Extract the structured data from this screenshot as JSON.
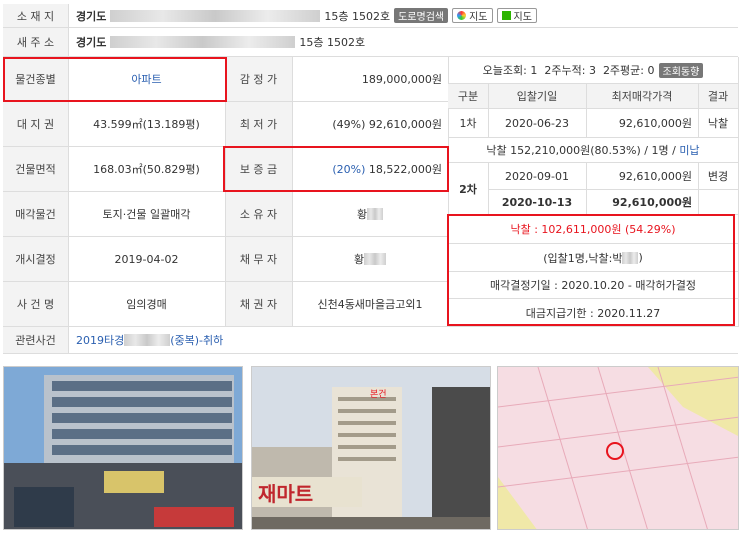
{
  "address": {
    "location_label": "소 재 지",
    "location_prefix": "경기도",
    "location_suffix": "15층 1502호",
    "road_btn": "도로명검색",
    "map_btn_1": "지도",
    "map_btn_2": "지도",
    "new_label": "새 주 소",
    "new_prefix": "경기도",
    "new_suffix": "15층 1502호"
  },
  "rows": {
    "kind_label": "물건종별",
    "kind_value": "아파트",
    "appraisal_label": "감 정 가",
    "appraisal_value": "189,000,000원",
    "land_label": "대 지 권",
    "land_value": "43.599㎡(13.189평)",
    "min_label": "최 저 가",
    "min_value": "(49%) 92,610,000원",
    "building_label": "건물면적",
    "building_value": "168.03㎡(50.829평)",
    "deposit_label": "보 증 금",
    "deposit_pct": "(20%)",
    "deposit_value": "18,522,000원",
    "sale_label": "매각물건",
    "sale_value": "토지·건물 일괄매각",
    "owner_label": "소 유 자",
    "owner_value": "황",
    "start_label": "개시결정",
    "start_value": "2019-04-02",
    "debtor_label": "채 무 자",
    "debtor_value": "황",
    "case_label": "사 건 명",
    "case_value": "임의경매",
    "creditor_label": "채 권 자",
    "creditor_value": "신천4동새마을금고외1",
    "related_label": "관련사건",
    "related_prefix": "2019타경",
    "related_suffix": "(중복)-취하"
  },
  "views": {
    "today_label": "오늘조회:",
    "today": "1",
    "twoweek_label": "2주누적:",
    "twoweek": "3",
    "avg_label": "2주평균:",
    "avg": "0",
    "trend_btn": "조회동향"
  },
  "auction": {
    "headers": [
      "구분",
      "입찰기일",
      "최저매각가격",
      "결과"
    ],
    "round1": "1차",
    "r1_date": "2020-06-23",
    "r1_price": "92,610,000원",
    "r1_result": "낙찰",
    "r1_note": "낙찰 152,210,000원(80.53%) / 1명 /",
    "r1_note_link": "미납",
    "r2_date": "2020-09-01",
    "r2_price": "92,610,000원",
    "r2_result": "변경",
    "round2": "2차",
    "r3_date": "2020-10-13",
    "r3_price": "92,610,000원"
  },
  "result": {
    "winning_label": "낙찰 :",
    "winning_price": "102,611,000원",
    "winning_pct": "(54.29%)",
    "bidders": "(입찰1명,낙찰:박",
    "bidders_end": ")",
    "decision": "매각결정기일 : 2020.10.20 - 매각허가결정",
    "payment": "대금지급기한 : 2020.11.27"
  },
  "photos": {
    "p2_label": "본건"
  },
  "colors": {
    "highlight": "#e8141e",
    "link": "#2a5fb0",
    "header_bg": "#f3f3f3"
  }
}
